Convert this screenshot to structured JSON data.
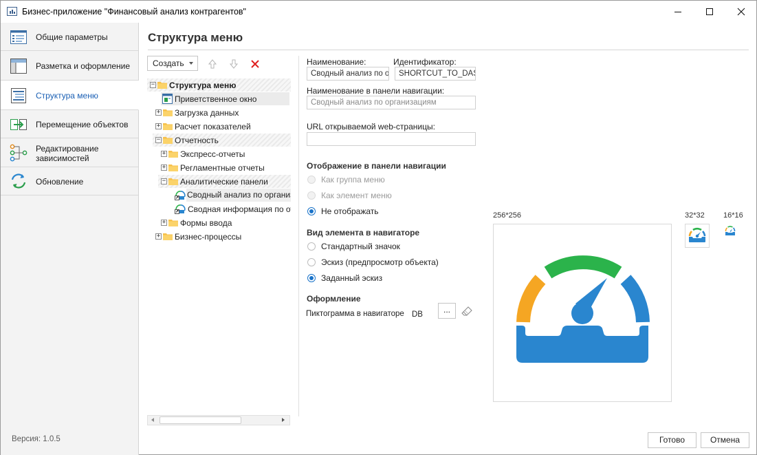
{
  "window": {
    "title": "Бизнес-приложение \"Финансовый анализ контрагентов\""
  },
  "sidebar": {
    "items": [
      {
        "label": "Общие параметры",
        "icon": "form-icon"
      },
      {
        "label": "Разметка и оформление",
        "icon": "layout-icon"
      },
      {
        "label": "Структура меню",
        "icon": "menu-structure-icon",
        "active": true
      },
      {
        "label": "Перемещение объектов",
        "icon": "move-objects-icon"
      },
      {
        "label": "Редактирование зависимостей",
        "icon": "dependencies-icon"
      },
      {
        "label": "Обновление",
        "icon": "update-icon"
      }
    ],
    "version": "Версия: 1.0.5"
  },
  "page": {
    "title": "Структура меню"
  },
  "toolbar": {
    "create_label": "Создать"
  },
  "tree": [
    {
      "label": "Структура меню"
    },
    {
      "label": "Приветственное окно"
    },
    {
      "label": "Загрузка данных"
    },
    {
      "label": "Расчет показателей"
    },
    {
      "label": "Отчетность"
    },
    {
      "label": "Экспресс-отчеты"
    },
    {
      "label": "Регламентные отчеты"
    },
    {
      "label": "Аналитические панели"
    },
    {
      "label": "Сводный анализ по организациям"
    },
    {
      "label": "Сводная информация по отраслям"
    },
    {
      "label": "Формы ввода"
    },
    {
      "label": "Бизнес-процессы"
    }
  ],
  "form": {
    "name_label": "Наименование:",
    "name_value": "Сводный анализ по организациям",
    "id_label": "Идентификатор:",
    "id_value": "SHORTCUT_TO_DASHBOARD",
    "nav_name_label": "Наименование в панели навигации:",
    "nav_name_placeholder": "Сводный анализ по организациям",
    "url_label": "URL открываемой web-страницы:",
    "url_value": "",
    "nav_display_title": "Отображение в панели навигации",
    "nav_display_options": [
      "Как группа меню",
      "Как элемент меню",
      "Не отображать"
    ],
    "nav_display_selected": "Не отображать",
    "element_view_title": "Вид элемента в навигаторе",
    "element_view_options": [
      "Стандартный значок",
      "Эскиз (предпросмотр объекта)",
      "Заданный эскиз"
    ],
    "element_view_selected": "Заданный эскиз",
    "design_title": "Оформление",
    "icon_label": "Пиктограмма в навигаторе",
    "icon_value": "DB",
    "browse_label": "..."
  },
  "preview": {
    "size_large": "256*256",
    "size_medium": "32*32",
    "size_small": "16*16",
    "colors": {
      "orange": "#f5a623",
      "green": "#2bb34b",
      "blue": "#2a86cf"
    }
  },
  "footer": {
    "ok_label": "Готово",
    "cancel_label": "Отмена"
  }
}
